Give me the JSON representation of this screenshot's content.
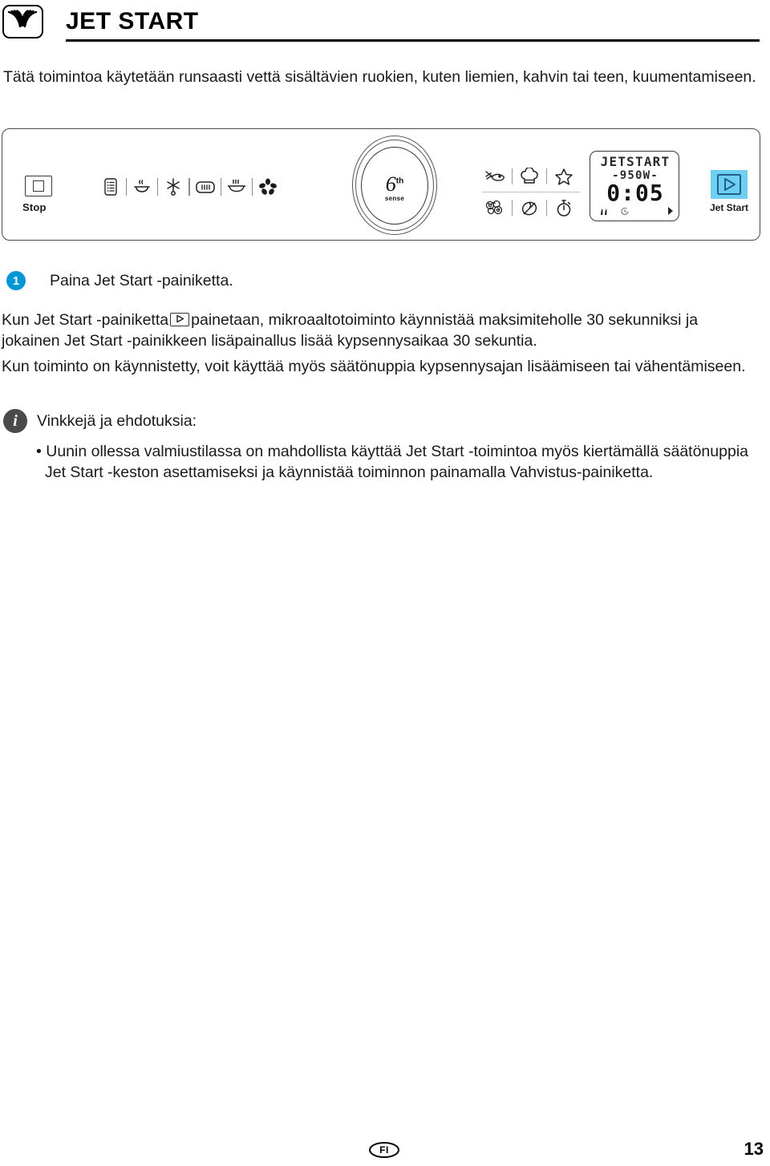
{
  "header": {
    "logo_icon": "microwave-waves-icon",
    "title": "JET START"
  },
  "intro": "Tätä toimintoa käytetään runsaasti vettä sisältävien ruokien, kuten liemien, kahvin tai teen, kuumentamiseen.",
  "panel": {
    "stop_button": {
      "label": "Stop",
      "icon": "stop-square-icon"
    },
    "function_icons": [
      "menu-list-icon",
      "steam-bowl-icon",
      "defrost-snowflake-icon",
      "grill-pan-icon",
      "crisp-plate-icon",
      "fan-icon"
    ],
    "knob": {
      "numeral": "6",
      "superscript": "th",
      "sublabel": "sense"
    },
    "program_icons": [
      "vegetables-fish-icon",
      "chef-hat-icon",
      "star-favourite-icon",
      "popcorn-icon",
      "no-cook-icon",
      "timer-icon"
    ],
    "display": {
      "line1": "JETSTART",
      "line2": "-950W-",
      "line3": "0:05",
      "status_icons": [
        "steam-indicator-icon",
        "clock-indicator-icon",
        "arrow-right-indicator-icon"
      ]
    },
    "jet_start_key": {
      "label": "Jet Start",
      "icon": "play-triangle-icon",
      "highlight_color": "#6ecff0",
      "glyph_color": "#1e5f8f"
    }
  },
  "step": {
    "number": "1",
    "badge_color": "#0096d6",
    "text": "Paina Jet Start -painiketta."
  },
  "paragraphs": {
    "p1_before_key": "Kun Jet Start -painiketta",
    "p1_after_key": "painetaan, mikroaaltotoiminto käynnistää maksimiteholle 30 sekunniksi ja jokainen Jet Start -painikkeen lisäpainallus lisää kypsennysaikaa 30 sekuntia.",
    "p2": "Kun toiminto on käynnistetty, voit käyttää myös säätönuppia kypsennysajan lisäämiseen tai vähentämiseen."
  },
  "tips": {
    "icon": "info-icon",
    "title": "Vinkkejä ja ehdotuksia:",
    "bullet": "• Uunin ollessa valmiustilassa on mahdollista käyttää Jet Start -toimintoa myös kiertämällä säätönuppia Jet Start -keston asettamiseksi ja käynnistää toiminnon painamalla Vahvistus-painiketta."
  },
  "footer": {
    "language": "FI",
    "page_number": "13"
  }
}
